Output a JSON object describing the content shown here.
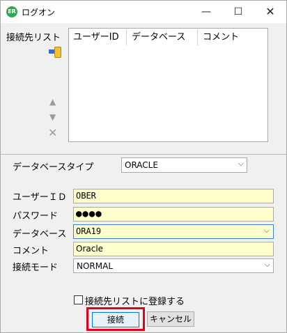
{
  "window": {
    "title": "ログオン",
    "app_icon_text": "ER",
    "minimize_glyph": "—",
    "maximize_glyph": "☐",
    "close_glyph": "✕"
  },
  "connection_list": {
    "label": "接続先リスト",
    "columns": [
      "ユーザーID",
      "データベース",
      "コメント"
    ],
    "rows": []
  },
  "side_icons": {
    "up": "▲",
    "down": "▼",
    "remove": "✕"
  },
  "form": {
    "database_type": {
      "label": "データベースタイプ",
      "value": "ORACLE"
    },
    "user_id": {
      "label": "ユーザーＩＤ",
      "value": "OBER"
    },
    "password": {
      "label": "パスワード",
      "value": "●●●●"
    },
    "database": {
      "label": "データベース",
      "value": "ORA19"
    },
    "comment": {
      "label": "コメント",
      "value": "Oracle"
    },
    "connect_mode": {
      "label": "接続モード",
      "value": "NORMAL"
    }
  },
  "chevron": "⌵",
  "save_to_list": {
    "label": "接続先リストに登録する",
    "checked": false
  },
  "buttons": {
    "connect": "接続",
    "cancel": "キャンセル"
  },
  "colors": {
    "highlight_border": "#e0001a",
    "input_background": "#ffffcc",
    "focus_border": "#0078d7"
  }
}
